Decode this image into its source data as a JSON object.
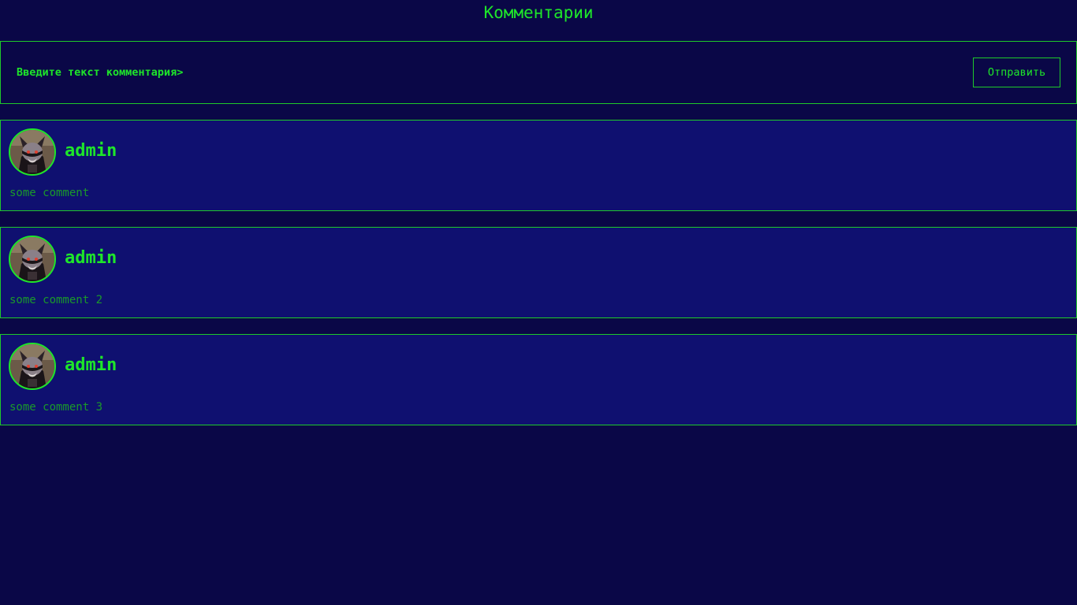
{
  "page": {
    "title": "Комментарии"
  },
  "composer": {
    "placeholder": "Введите текст комментария>",
    "send_label": "Отправить"
  },
  "comments": [
    {
      "author": "admin",
      "text": "some comment",
      "avatar_icon": "raccoon-avatar-icon"
    },
    {
      "author": "admin",
      "text": "some comment 2",
      "avatar_icon": "raccoon-avatar-icon"
    },
    {
      "author": "admin",
      "text": "some comment 3",
      "avatar_icon": "raccoon-avatar-icon"
    }
  ],
  "colors": {
    "background": "#0a0747",
    "card_background": "#0f1070",
    "accent": "#1ee62a",
    "muted_text": "#1a9a2a"
  }
}
